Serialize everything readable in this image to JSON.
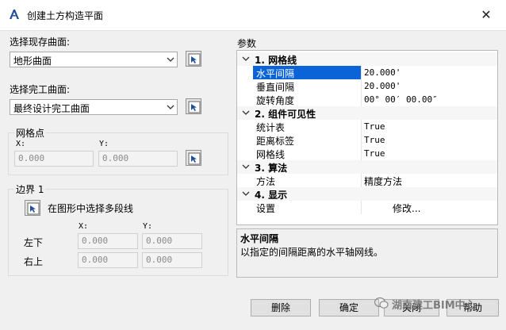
{
  "window": {
    "title": "创建土方构造平面",
    "close_symbol": "✕"
  },
  "left": {
    "existing_label": "选择现存曲面:",
    "existing_value": "地形曲面",
    "final_label": "选择完工曲面:",
    "final_value": "最终设计完工曲面",
    "grid_point": {
      "title": "网格点",
      "x_label": "X:",
      "y_label": "Y:",
      "x_value": "0.000",
      "y_value": "0.000"
    },
    "boundary": {
      "title": "边界 1",
      "pick_label": "在图形中选择多段线",
      "x_label": "X:",
      "y_label": "Y:",
      "lower_left_label": "左下",
      "upper_right_label": "右上",
      "ll_x": "0.000",
      "ll_y": "0.000",
      "ur_x": "0.000",
      "ur_y": "0.000"
    }
  },
  "params": {
    "title": "参数",
    "categories": [
      {
        "label": "1. 网格线",
        "rows": [
          {
            "name": "水平间隔",
            "value": "20.000'"
          },
          {
            "name": "垂直间隔",
            "value": "20.000'"
          },
          {
            "name": "旋转角度",
            "value": "00° 00′ 00.00″"
          }
        ]
      },
      {
        "label": "2. 组件可见性",
        "rows": [
          {
            "name": "统计表",
            "value": "True"
          },
          {
            "name": "距离标签",
            "value": "True"
          },
          {
            "name": "网格线",
            "value": "True"
          }
        ]
      },
      {
        "label": "3. 算法",
        "rows": [
          {
            "name": "方法",
            "value": "精度方法"
          }
        ]
      },
      {
        "label": "4. 显示",
        "rows": [
          {
            "name": "设置",
            "value": "修改..."
          }
        ]
      }
    ],
    "description_title": "水平间隔",
    "description_text": "以指定的间隔距离的水平轴网线。"
  },
  "buttons": {
    "delete": "删除",
    "ok": "确定",
    "close": "关闭",
    "help": "帮助"
  },
  "watermark": "湖南建工BIM中心",
  "colors": {
    "selection": "#0a64d8",
    "app_icon": "#1f4e9c"
  }
}
